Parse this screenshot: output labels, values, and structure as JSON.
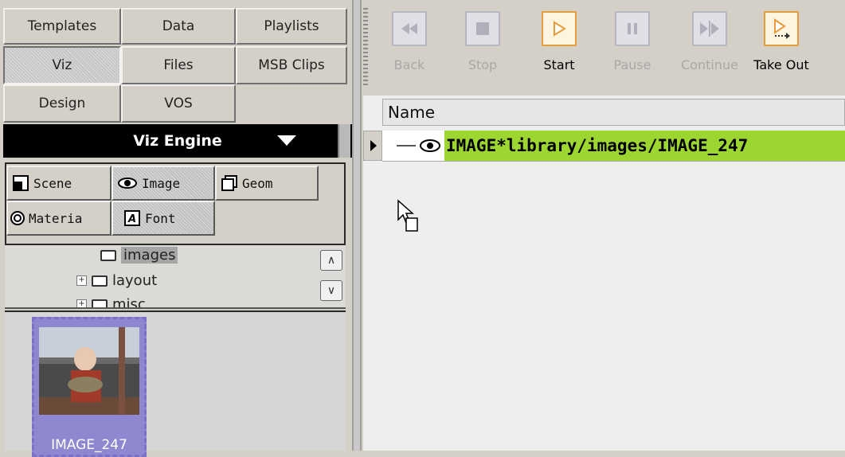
{
  "left_tabs": [
    {
      "label": "Templates",
      "active": false
    },
    {
      "label": "Data",
      "active": false
    },
    {
      "label": "Playlists",
      "active": false
    },
    {
      "label": "Viz",
      "active": true
    },
    {
      "label": "Files",
      "active": false
    },
    {
      "label": "MSB Clips",
      "active": false
    },
    {
      "label": "Design",
      "active": false
    },
    {
      "label": "VOS",
      "active": false
    }
  ],
  "engine": {
    "label": "Viz Engine"
  },
  "sub_tabs": [
    {
      "label": "Scene",
      "icon": "scene-icon"
    },
    {
      "label": "Image",
      "icon": "eye-icon",
      "active": true
    },
    {
      "label": "Geom",
      "icon": "geom-icon"
    },
    {
      "label": "Materia",
      "icon": "material-icon"
    },
    {
      "label": "Font",
      "icon": "font-icon",
      "active": true
    }
  ],
  "tree": {
    "items": [
      {
        "label": "images",
        "selected": true,
        "expandable": false
      },
      {
        "label": "layout",
        "selected": false,
        "expandable": true
      },
      {
        "label": "misc",
        "selected": false,
        "expandable": true
      }
    ]
  },
  "thumbnail": {
    "label": "IMAGE_247"
  },
  "toolbar": {
    "buttons": [
      {
        "label": "Back",
        "enabled": false,
        "icon": "rewind-icon"
      },
      {
        "label": "Stop",
        "enabled": false,
        "icon": "stop-icon"
      },
      {
        "label": "Start",
        "enabled": true,
        "icon": "play-icon"
      },
      {
        "label": "Pause",
        "enabled": false,
        "icon": "pause-icon"
      },
      {
        "label": "Continue",
        "enabled": false,
        "icon": "continue-icon"
      },
      {
        "label": "Take Out",
        "enabled": true,
        "icon": "take-out-icon"
      }
    ]
  },
  "table": {
    "column_name": "Name",
    "rows": [
      {
        "name": "IMAGE*library/images/IMAGE_247",
        "highlight": "#9dd531"
      }
    ]
  },
  "colors": {
    "highlight_green": "#9dd531",
    "enabled_orange": "#e89b3a",
    "thumb_border": "#7b70c8"
  }
}
